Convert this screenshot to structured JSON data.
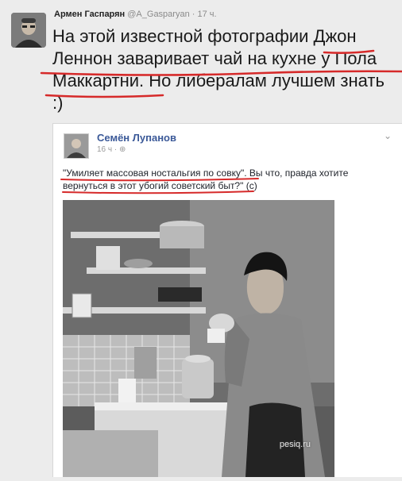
{
  "tweet": {
    "author_name": "Армен Гаспарян",
    "author_handle": "@A_Gasparyan",
    "separator": "·",
    "time": "17 ч.",
    "text_lines": [
      "На этой известной фотографии Джон",
      "Леннон заваривает чай на кухне у Пола",
      "Маккартни. Но либералам лучшем знать",
      ":)"
    ]
  },
  "fb_post": {
    "author_name": "Семён Лупанов",
    "time": "16 ч",
    "separator": "·",
    "text_lines": [
      "\"Умиляет массовая ностальгия по совку\". Вы что, правда хотите",
      "вернуться в этот убогий советский быт?\" (с)"
    ],
    "photo_icon": "photo-icon"
  },
  "watermark": "pesiq.ru",
  "colors": {
    "underline_red": "#d62a2a",
    "fb_name_blue": "#3b5998"
  }
}
